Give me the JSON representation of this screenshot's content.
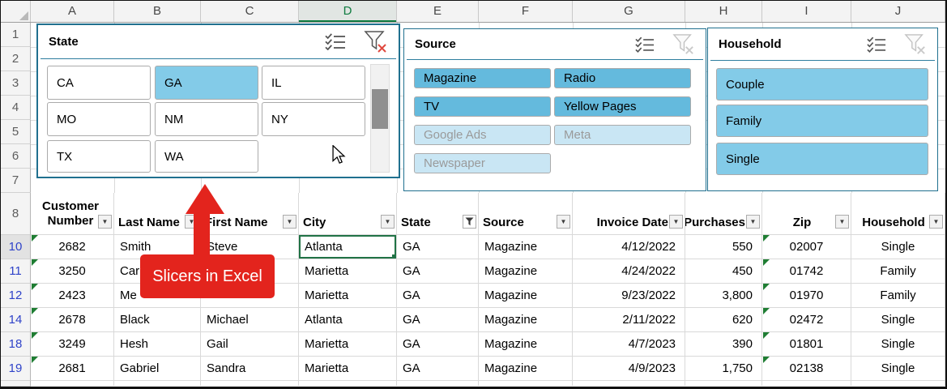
{
  "chrome": {
    "column_letters": [
      "A",
      "B",
      "C",
      "D",
      "E",
      "F",
      "G",
      "H",
      "I",
      "J"
    ],
    "selected_column": "D",
    "upper_rows": [
      "1",
      "2",
      "3",
      "4",
      "5",
      "6",
      "7",
      "8"
    ],
    "data_rows": [
      "10",
      "11",
      "12",
      "14",
      "18",
      "19"
    ],
    "selected_row": "10",
    "selected_cell": "Atlanta"
  },
  "slicers": [
    {
      "title": "State",
      "filter_applied": true,
      "items": [
        {
          "label": "CA",
          "state": "unselected"
        },
        {
          "label": "GA",
          "state": "selected"
        },
        {
          "label": "IL",
          "state": "unselected"
        },
        {
          "label": "MO",
          "state": "unselected"
        },
        {
          "label": "NM",
          "state": "unselected"
        },
        {
          "label": "NY",
          "state": "unselected"
        },
        {
          "label": "TX",
          "state": "unselected"
        },
        {
          "label": "WA",
          "state": "unselected"
        }
      ]
    },
    {
      "title": "Source",
      "filter_applied": false,
      "items": [
        {
          "label": "Magazine",
          "state": "selected-with-data"
        },
        {
          "label": "Radio",
          "state": "selected-with-data"
        },
        {
          "label": "TV",
          "state": "selected-with-data"
        },
        {
          "label": "Yellow Pages",
          "state": "selected-with-data"
        },
        {
          "label": "Google Ads",
          "state": "selected-no-data"
        },
        {
          "label": "Meta",
          "state": "selected-no-data"
        },
        {
          "label": "Newspaper",
          "state": "selected-no-data"
        }
      ]
    },
    {
      "title": "Household",
      "filter_applied": false,
      "items": [
        {
          "label": "Couple",
          "state": "selected"
        },
        {
          "label": "Family",
          "state": "selected"
        },
        {
          "label": "Single",
          "state": "selected"
        }
      ]
    }
  ],
  "table": {
    "headers": [
      "Customer Number",
      "Last Name",
      "First Name",
      "City",
      "State",
      "Source",
      "Invoice Date",
      "Purchases",
      "Zip",
      "Household"
    ],
    "filtered_header": "State",
    "rows": [
      {
        "customer_number": "2682",
        "last_name": "Smith",
        "first_name": "Steve",
        "city": "Atlanta",
        "state": "GA",
        "source": "Magazine",
        "invoice_date": "4/12/2022",
        "purchases": "550",
        "zip": "02007",
        "household": "Single"
      },
      {
        "customer_number": "3250",
        "last_name": "Car",
        "first_name": "",
        "city": "Marietta",
        "state": "GA",
        "source": "Magazine",
        "invoice_date": "4/24/2022",
        "purchases": "450",
        "zip": "01742",
        "household": "Family"
      },
      {
        "customer_number": "2423",
        "last_name": "Me",
        "first_name": "",
        "city": "Marietta",
        "state": "GA",
        "source": "Magazine",
        "invoice_date": "9/23/2022",
        "purchases": "3,800",
        "zip": "01970",
        "household": "Family"
      },
      {
        "customer_number": "2678",
        "last_name": "Black",
        "first_name": "Michael",
        "city": "Atlanta",
        "state": "GA",
        "source": "Magazine",
        "invoice_date": "2/11/2022",
        "purchases": "620",
        "zip": "02472",
        "household": "Single"
      },
      {
        "customer_number": "3249",
        "last_name": "Hesh",
        "first_name": "Gail",
        "city": "Marietta",
        "state": "GA",
        "source": "Magazine",
        "invoice_date": "4/7/2023",
        "purchases": "390",
        "zip": "01801",
        "household": "Single"
      },
      {
        "customer_number": "2681",
        "last_name": "Gabriel",
        "first_name": "Sandra",
        "city": "Marietta",
        "state": "GA",
        "source": "Magazine",
        "invoice_date": "4/9/2023",
        "purchases": "1,750",
        "zip": "02138",
        "household": "Single"
      }
    ]
  },
  "callout": {
    "label": "Slicers in Excel"
  },
  "icons": {
    "multi_select": "checklist",
    "clear_filter": "funnel-with-x",
    "column_filter": "funnel",
    "dropdown": "▼",
    "error_indicator": "green-triangle",
    "select_all": "corner-triangle"
  },
  "colors": {
    "slicer_border": "#20708F",
    "selected_blue": "#83CBE8",
    "selected_with_data_blue": "#64BADD",
    "selected_no_data_blue": "#C9E6F4",
    "excel_green": "#217346",
    "error_triangle_green": "#1F7D33",
    "filtered_row_number_blue": "#2F43C9",
    "callout_red": "#E3241D"
  }
}
